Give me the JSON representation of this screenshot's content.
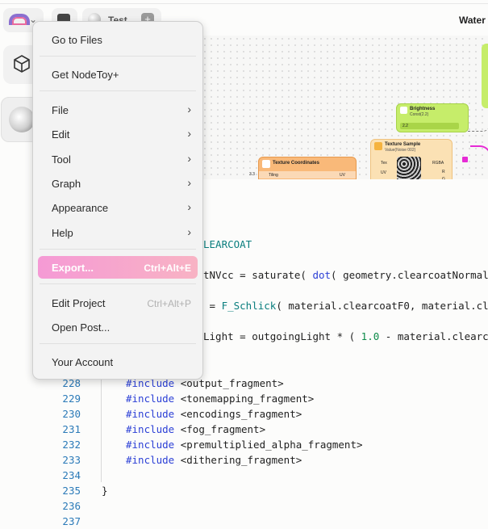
{
  "toolbar": {
    "doc_name": "Test",
    "plus": "+",
    "title": "Water"
  },
  "graph": {
    "brightness": {
      "title": "Brightness",
      "subtitle": "Const(2.2)",
      "value": "2.2"
    },
    "texture_sample": {
      "title": "Texture Sample",
      "subtitle": "Value(Noise 002)",
      "tex": "Tex",
      "uv": "UV",
      "rgba": "RGBA",
      "r": "R",
      "g": "G"
    },
    "texture_coordinates": {
      "title": "Texture Coordinates",
      "tiling": "Tiling",
      "uv": "UV",
      "value": "3.3"
    }
  },
  "menu": {
    "items": [
      {
        "label": "Go to Files"
      },
      {
        "label": "Get NodeToy+"
      },
      {
        "label": "File",
        "arrow": "›"
      },
      {
        "label": "Edit",
        "arrow": "›"
      },
      {
        "label": "Tool",
        "arrow": "›"
      },
      {
        "label": "Graph",
        "arrow": "›"
      },
      {
        "label": "Appearance",
        "arrow": "›"
      },
      {
        "label": "Help",
        "arrow": "›"
      },
      {
        "label": "Export...",
        "shortcut": "Ctrl+Alt+E"
      },
      {
        "label": "Edit Project",
        "shortcut": "Ctrl+Alt+P"
      },
      {
        "label": "Open Post..."
      },
      {
        "label": "Your Account"
      }
    ]
  },
  "code": {
    "partial_lines": [
      {
        "kw": "",
        "pre": "",
        "fn": "LEARCOAT",
        "rest": ""
      },
      {
        "pre": "tNVcc = saturate( ",
        "kw": "dot",
        "rest": "( geometry.clearcoatNormal"
      },
      {
        "pre": " = ",
        "fn": "F_Schlick",
        "rest": "( material.clearcoatF0, material.cl"
      },
      {
        "pre": "Light = outgoingLight * ( ",
        "num": "1.0",
        "rest": " - material.clearc"
      }
    ],
    "lines": [
      {
        "num": "228",
        "kw": "#include",
        "rest": " <output_fragment>"
      },
      {
        "num": "229",
        "kw": "#include",
        "rest": " <tonemapping_fragment>"
      },
      {
        "num": "230",
        "kw": "#include",
        "rest": " <encodings_fragment>"
      },
      {
        "num": "231",
        "kw": "#include",
        "rest": " <fog_fragment>"
      },
      {
        "num": "232",
        "kw": "#include",
        "rest": " <premultiplied_alpha_fragment>"
      },
      {
        "num": "233",
        "kw": "#include",
        "rest": " <dithering_fragment>"
      },
      {
        "num": "234",
        "kw": "",
        "rest": ""
      },
      {
        "num": "235",
        "kw": "",
        "rest": "}"
      },
      {
        "num": "236",
        "kw": "",
        "rest": ""
      },
      {
        "num": "237",
        "kw": "",
        "rest": ""
      }
    ]
  },
  "colors": {
    "accent_export": "#f59ad5",
    "keyword": "#2b3fd6",
    "line_number": "#2b7ab8"
  }
}
